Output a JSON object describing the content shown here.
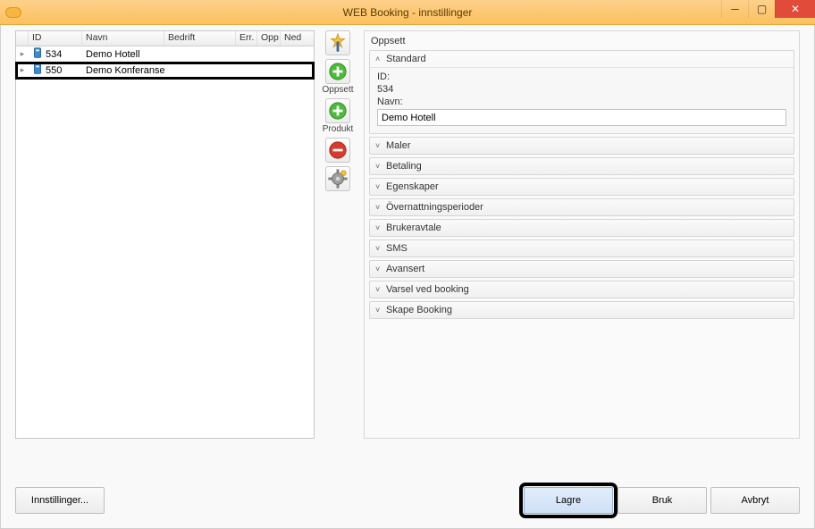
{
  "window": {
    "title": "WEB Booking - innstillinger"
  },
  "grid": {
    "columns": {
      "id": "ID",
      "navn": "Navn",
      "bedrift": "Bedrift",
      "err": "Err.",
      "opp": "Opp",
      "ned": "Ned"
    },
    "rows": [
      {
        "id": "534",
        "navn": "Demo Hotell",
        "bedrift": "",
        "err": "",
        "opp": "",
        "ned": ""
      },
      {
        "id": "550",
        "navn": "Demo Konferansesenter",
        "bedrift": "",
        "err": "",
        "opp": "",
        "ned": ""
      }
    ]
  },
  "toolbar": {
    "wizard": "",
    "oppsett": "Oppsett",
    "produkt": "Produkt",
    "delete": "",
    "settings": ""
  },
  "panel": {
    "title": "Oppsett",
    "standard": {
      "header": "Standard",
      "id_label": "ID:",
      "id_value": "534",
      "navn_label": "Navn:",
      "navn_value": "Demo Hotell"
    },
    "sections": {
      "maler": "Maler",
      "betaling": "Betaling",
      "egenskaper": "Egenskaper",
      "overnattningsperioder": "Övernattningsperioder",
      "brukeravtale": "Brukeravtale",
      "sms": "SMS",
      "avansert": "Avansert",
      "varsel": "Varsel ved booking",
      "skape": "Skape Booking"
    }
  },
  "buttons": {
    "innstillinger": "Innstillinger...",
    "lagre": "Lagre",
    "bruk": "Bruk",
    "avbryt": "Avbryt"
  }
}
